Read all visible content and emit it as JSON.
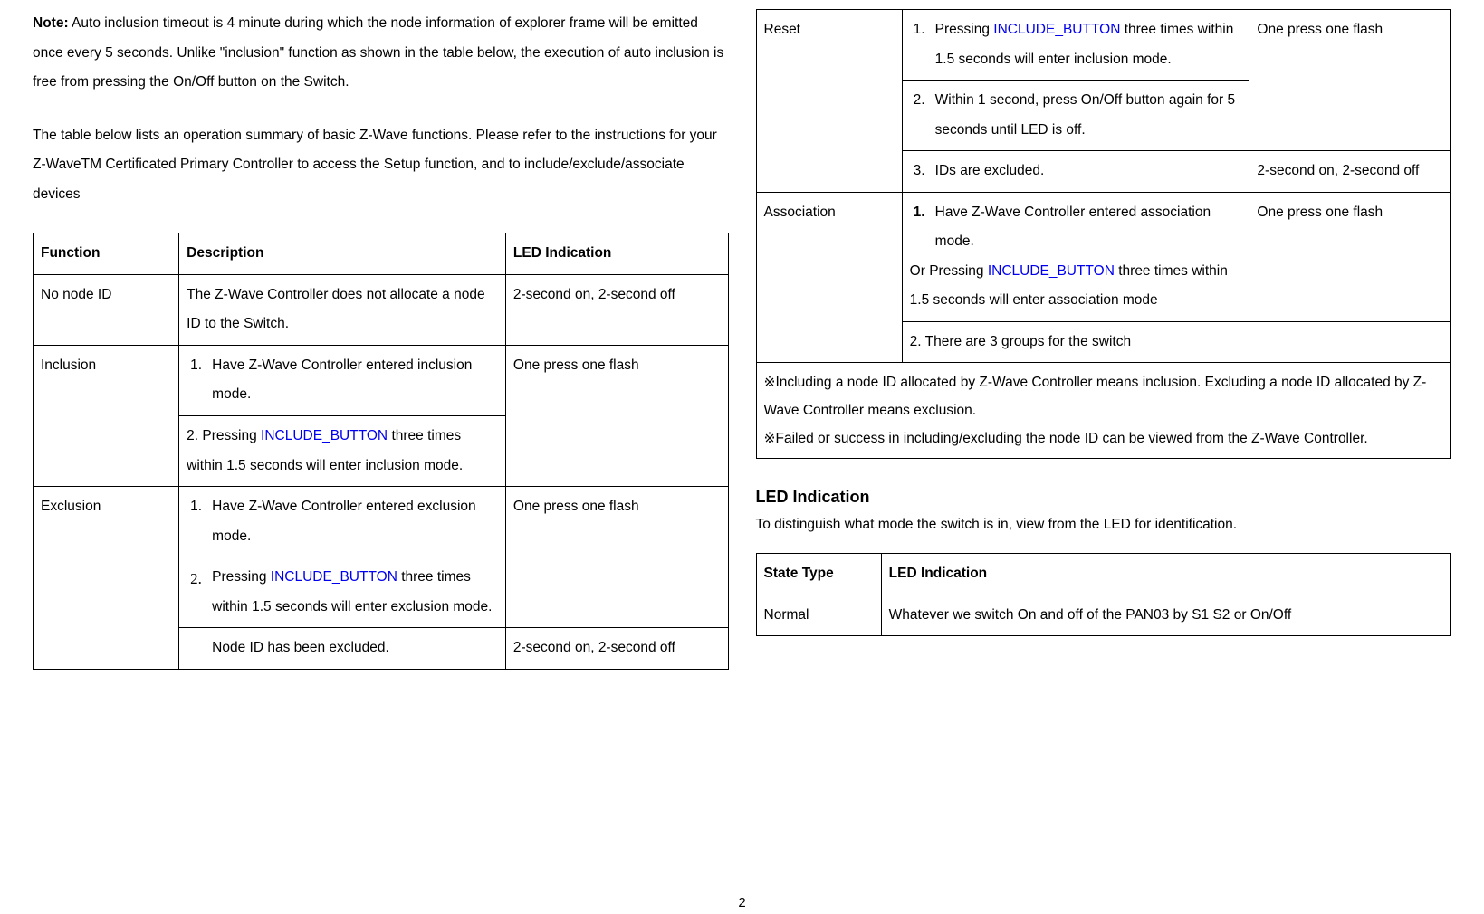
{
  "left": {
    "note_label": "Note:",
    "note_body": " Auto inclusion timeout is 4 minute during which the node information of explorer frame will be emitted once every 5 seconds.  Unlike \"inclusion\" function as shown in the table below, the execution of auto inclusion is free from pressing the On/Off button on the Switch.",
    "intro": "The table below lists an operation summary of basic Z-Wave functions. Please refer to the instructions for your Z-WaveTM Certificated Primary Controller to access the Setup function, and to include/exclude/associate devices",
    "table": {
      "h_func": "Function",
      "h_desc": "Description",
      "h_led": "LED Indication",
      "r1_func": "No node ID",
      "r1_desc": "The Z-Wave Controller does not allocate a node ID to the Switch.",
      "r1_led": "2-second on, 2-second off",
      "r2_func": "Inclusion",
      "r2_d1_n": "1.",
      "r2_d1_b": "Have Z-Wave Controller entered inclusion mode.",
      "r2_d2_pre": "2.  Pressing ",
      "r2_d2_link": "INCLUDE_BUTTON",
      "r2_d2_post": " three times within 1.5 seconds will enter inclusion mode.",
      "r2_led": "One press one flash",
      "r3_func": "Exclusion",
      "r3_d1_n": "1.",
      "r3_d1_b": "Have Z-Wave Controller entered exclusion mode.",
      "r3_d2_n": "2.",
      "r3_d2_pre": "Pressing ",
      "r3_d2_link": "INCLUDE_BUTTON",
      "r3_d2_post": " three times within 1.5 seconds will enter exclusion mode.",
      "r3_led": "One press one flash",
      "r3_d3": "Node ID has been excluded.",
      "r3_led2": "2-second on, 2-second off"
    }
  },
  "right": {
    "table": {
      "r1_func": "Reset",
      "r1_d1_n": "1.",
      "r1_d1_pre": "Pressing ",
      "r1_d1_link": "INCLUDE_BUTTON",
      "r1_d1_post": " three times within 1.5 seconds will enter inclusion mode.",
      "r1_led1": "One press one flash",
      "r1_d2_n": "2.",
      "r1_d2_b": "Within 1 second, press On/Off button again for 5 seconds until LED is off.",
      "r1_d3_n": "3.",
      "r1_d3_b": "IDs are excluded.",
      "r1_led2": "2-second on, 2-second off",
      "r2_func": "Association",
      "r2_d1_n": "1.",
      "r2_d1_b": "Have Z-Wave Controller entered association mode.",
      "r2_d1_or_pre": "Or  Pressing ",
      "r2_d1_or_link": "INCLUDE_BUTTON",
      "r2_d1_or_post": " three times within 1.5 seconds will enter association mode",
      "r2_led": "One press one flash",
      "r2_d2": "2.  There are 3 groups for the switch",
      "foot1": "※Including a node ID allocated by Z-Wave Controller means inclusion.  Excluding a node ID allocated by Z-Wave Controller means exclusion.",
      "foot2": "※Failed or success in including/excluding the node ID can be viewed from the Z-Wave Controller."
    },
    "led_heading": "LED Indication",
    "led_intro": "To distinguish what mode the switch is in, view from the LED for identification.",
    "led_table": {
      "h_state": "State Type",
      "h_led": "LED Indication",
      "r1_state": "Normal",
      "r1_led": "Whatever we switch On and off of the PAN03 by S1 S2 or On/Off"
    }
  },
  "page_number": "2"
}
